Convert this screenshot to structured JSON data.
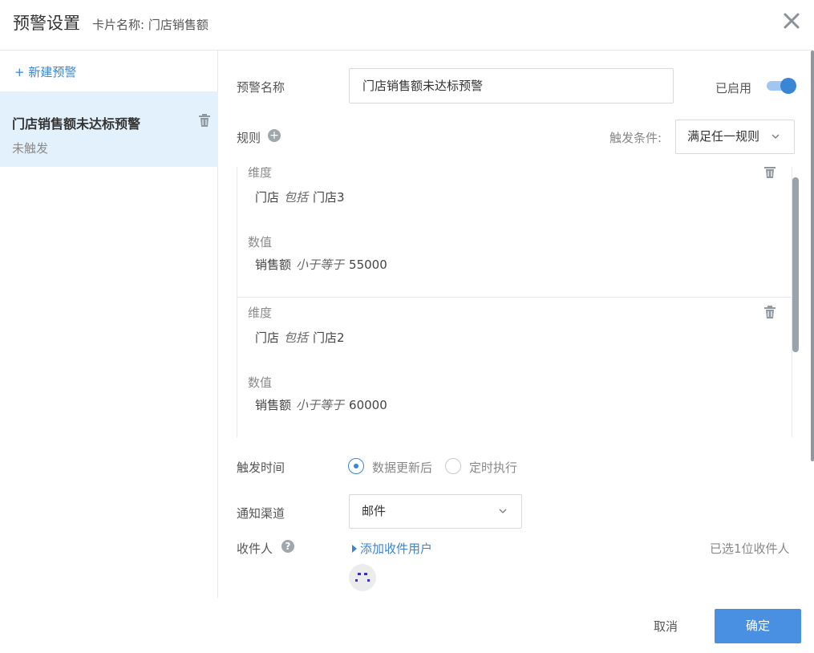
{
  "header": {
    "title": "预警设置",
    "subtitle": "卡片名称: 门店销售额",
    "close_icon": "close-icon"
  },
  "sidebar": {
    "new_alert_label": "+ 新建预警",
    "items": [
      {
        "name": "门店销售额未达标预警",
        "status": "未触发",
        "delete_icon": "trash-icon"
      }
    ]
  },
  "form": {
    "name_label": "预警名称",
    "name_value": "门店销售额未达标预警",
    "enabled_label": "已启用",
    "enabled": true,
    "rules_label": "规则",
    "add_rule_icon": "plus-circle-icon",
    "trigger_condition_label": "触发条件:",
    "trigger_condition_value": "满足任一规则",
    "rules": [
      {
        "dimension_label": "维度",
        "dimension": {
          "field": "门店",
          "op": "包括",
          "value": "门店3"
        },
        "measure_label": "数值",
        "measure": {
          "field": "销售额",
          "op": "小于等于",
          "value": "55000"
        }
      },
      {
        "dimension_label": "维度",
        "dimension": {
          "field": "门店",
          "op": "包括",
          "value": "门店2"
        },
        "measure_label": "数值",
        "measure": {
          "field": "销售额",
          "op": "小于等于",
          "value": "60000"
        }
      }
    ],
    "trigger_time_label": "触发时间",
    "trigger_time_options": [
      {
        "label": "数据更新后",
        "selected": true
      },
      {
        "label": "定时执行",
        "selected": false
      }
    ],
    "channel_label": "通知渠道",
    "channel_value": "邮件",
    "recipient_label": "收件人",
    "recipient_help_icon": "help-circle-icon",
    "add_recipient_label": "添加收件用户",
    "selected_count": "已选1位收件人"
  },
  "footer": {
    "cancel_label": "取消",
    "ok_label": "确定"
  },
  "colors": {
    "accent": "#3a86d6",
    "primary_button": "#4a90e2",
    "selected_item_bg": "#e3f1fc"
  }
}
